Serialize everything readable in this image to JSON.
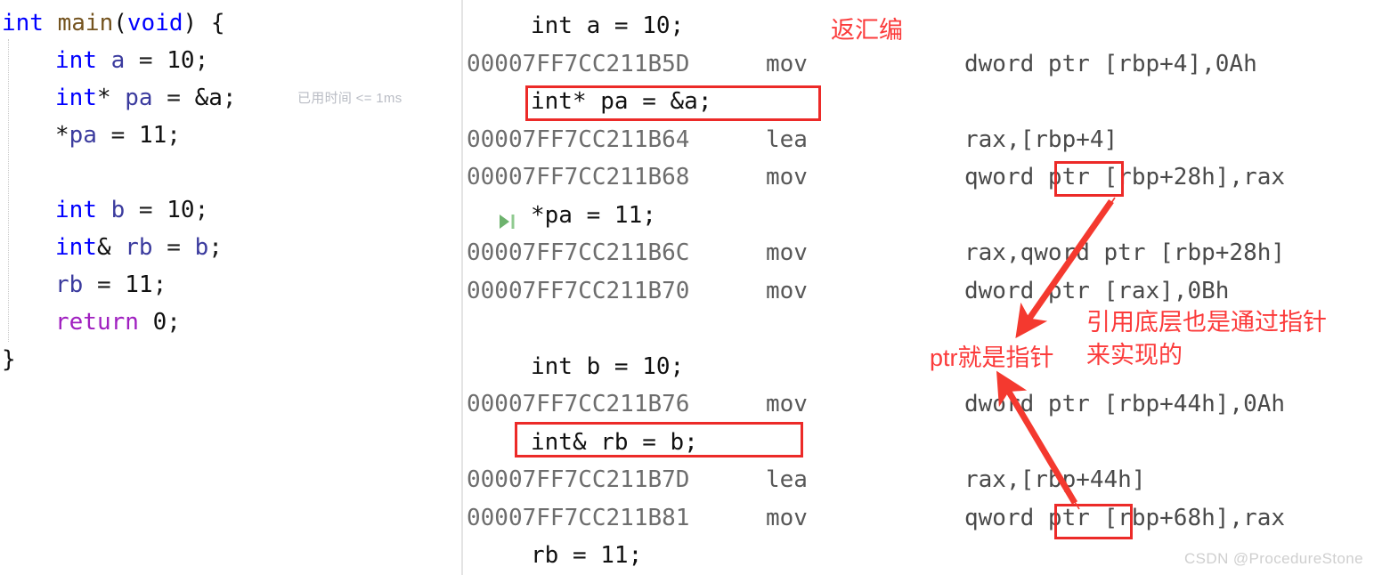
{
  "editor": {
    "elapsed_hint": "已用时间 <= 1ms",
    "lines": [
      {
        "indent": 0,
        "tokens": [
          {
            "t": "int",
            "c": "kw-type"
          },
          {
            "t": " "
          },
          {
            "t": "main",
            "c": "fn-name"
          },
          {
            "t": "(",
            "c": "punct"
          },
          {
            "t": "void",
            "c": "kw-type"
          },
          {
            "t": ") {",
            "c": "punct"
          }
        ]
      },
      {
        "indent": 1,
        "tokens": [
          {
            "t": "int",
            "c": "kw-type"
          },
          {
            "t": " "
          },
          {
            "t": "a",
            "c": "var-name"
          },
          {
            "t": " = "
          },
          {
            "t": "10",
            "c": "num"
          },
          {
            "t": ";"
          }
        ]
      },
      {
        "indent": 1,
        "tokens": [
          {
            "t": "int",
            "c": "kw-type"
          },
          {
            "t": "*",
            "c": "punct"
          },
          {
            "t": " "
          },
          {
            "t": "pa",
            "c": "var-name"
          },
          {
            "t": " = "
          },
          {
            "t": "&a",
            "c": "punct"
          },
          {
            "t": ";"
          }
        ]
      },
      {
        "indent": 1,
        "tokens": [
          {
            "t": "*",
            "c": "punct"
          },
          {
            "t": "pa",
            "c": "var-name"
          },
          {
            "t": " = "
          },
          {
            "t": "11",
            "c": "num"
          },
          {
            "t": ";"
          }
        ]
      },
      {
        "indent": 1,
        "tokens": []
      },
      {
        "indent": 1,
        "tokens": [
          {
            "t": "int",
            "c": "kw-type"
          },
          {
            "t": " "
          },
          {
            "t": "b",
            "c": "var-name"
          },
          {
            "t": " = "
          },
          {
            "t": "10",
            "c": "num"
          },
          {
            "t": ";"
          }
        ]
      },
      {
        "indent": 1,
        "tokens": [
          {
            "t": "int",
            "c": "kw-type"
          },
          {
            "t": "&",
            "c": "punct"
          },
          {
            "t": " "
          },
          {
            "t": "rb",
            "c": "var-name"
          },
          {
            "t": " = "
          },
          {
            "t": "b",
            "c": "var-name"
          },
          {
            "t": ";"
          }
        ]
      },
      {
        "indent": 1,
        "tokens": [
          {
            "t": "rb",
            "c": "var-name"
          },
          {
            "t": " = "
          },
          {
            "t": "11",
            "c": "num"
          },
          {
            "t": ";"
          }
        ]
      },
      {
        "indent": 1,
        "tokens": [
          {
            "t": "return",
            "c": "kw-ctrl"
          },
          {
            "t": " "
          },
          {
            "t": "0",
            "c": "num"
          },
          {
            "t": ";"
          }
        ]
      },
      {
        "indent": 0,
        "tokens": [
          {
            "t": "}",
            "c": "punct"
          }
        ]
      }
    ],
    "plain_text": [
      "int main(void) {",
      "    int a = 10;",
      "    int* pa = &a;",
      "    *pa = 11;",
      "",
      "    int b = 10;",
      "    int& rb = b;",
      "    rb = 11;",
      "    return 0;",
      "}"
    ]
  },
  "disassembly": {
    "rows": [
      {
        "kind": "source",
        "text": "int a = 10;",
        "marker": "none",
        "highlight": false
      },
      {
        "kind": "asm",
        "address": "00007FF7CC211B5D",
        "mnemonic": "mov",
        "operands": "dword ptr [rbp+4],0Ah"
      },
      {
        "kind": "source",
        "text": "int* pa = &a;",
        "marker": "none",
        "highlight": true
      },
      {
        "kind": "asm",
        "address": "00007FF7CC211B64",
        "mnemonic": "lea",
        "operands": "rax,[rbp+4]"
      },
      {
        "kind": "asm",
        "address": "00007FF7CC211B68",
        "mnemonic": "mov",
        "operands": "qword ptr [rbp+28h],rax"
      },
      {
        "kind": "source",
        "text": "*pa = 11;",
        "marker": "run-to-cursor",
        "highlight": false
      },
      {
        "kind": "asm",
        "address": "00007FF7CC211B6C",
        "mnemonic": "mov",
        "operands": "rax,qword ptr [rbp+28h]"
      },
      {
        "kind": "asm",
        "address": "00007FF7CC211B70",
        "mnemonic": "mov",
        "operands": "dword ptr [rax],0Bh"
      },
      {
        "kind": "blank"
      },
      {
        "kind": "source",
        "text": "int b = 10;",
        "marker": "none",
        "highlight": false
      },
      {
        "kind": "asm",
        "address": "00007FF7CC211B76",
        "mnemonic": "mov",
        "operands": "dword ptr [rbp+44h],0Ah"
      },
      {
        "kind": "source",
        "text": "int& rb = b;",
        "marker": "none",
        "highlight": true
      },
      {
        "kind": "asm",
        "address": "00007FF7CC211B7D",
        "mnemonic": "lea",
        "operands": "rax,[rbp+44h]"
      },
      {
        "kind": "asm",
        "address": "00007FF7CC211B81",
        "mnemonic": "mov",
        "operands": "qword ptr [rbp+68h],rax"
      },
      {
        "kind": "source",
        "text": "rb = 11;",
        "marker": "none",
        "highlight": false
      }
    ]
  },
  "annotations": {
    "title": "返汇编",
    "ptr_note": "ptr就是指针",
    "ref_note_line1": "引用底层也是通过指针",
    "ref_note_line2": "来实现的"
  },
  "watermark": "CSDN @ProcedureStone",
  "colors": {
    "annotation_red": "#fb3b3b",
    "box_red": "#ec2a28",
    "arrow_red": "#f4392f",
    "keyword_blue": "#0000ff",
    "control_purple": "#a020c0",
    "function_brown": "#74531f",
    "variable_navy": "#3b3b9e",
    "address_gray": "#6d6d6d",
    "marker_green": "#6db26d",
    "watermark_gray": "#cfcfcf",
    "divider_gray": "#e4e4e4"
  }
}
